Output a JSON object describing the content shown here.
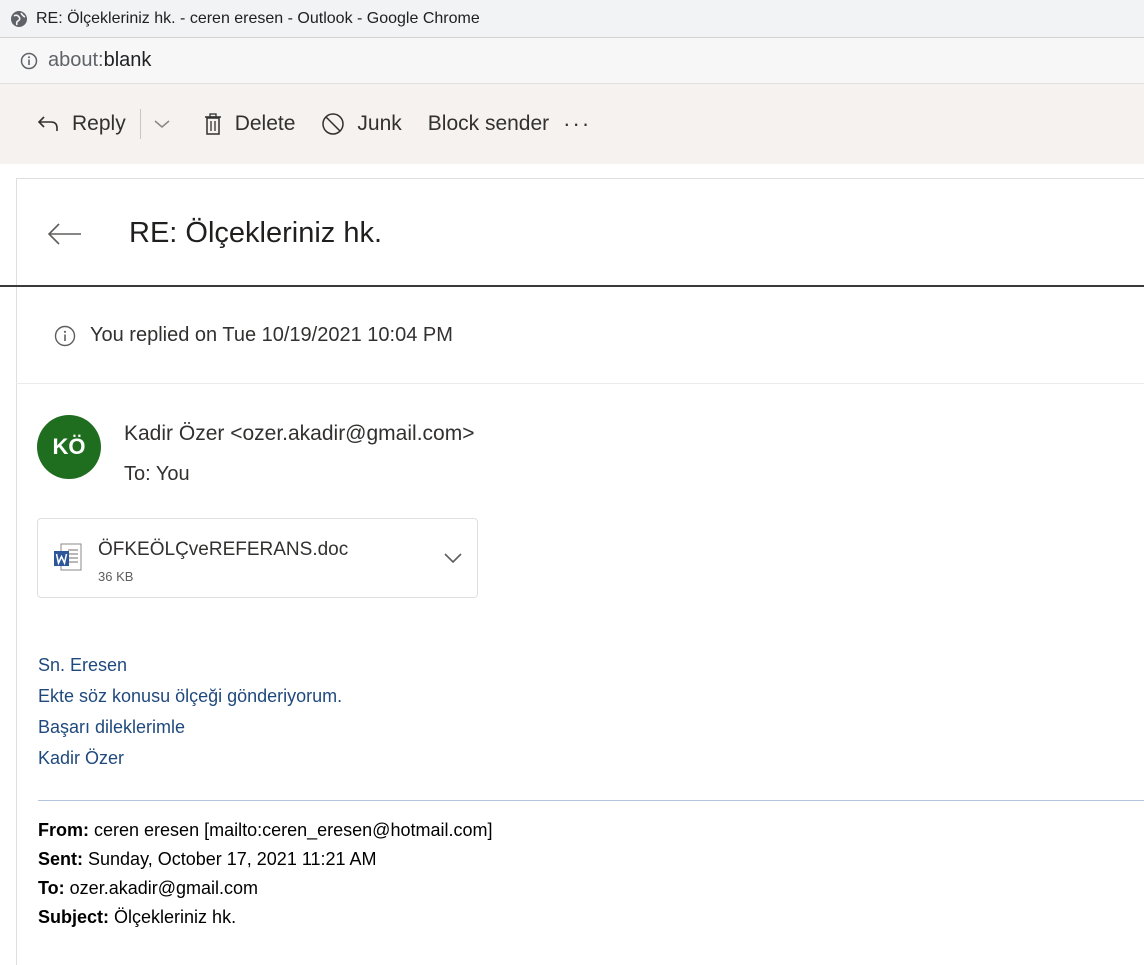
{
  "window": {
    "title": "RE: Ölçekleriniz hk. - ceren eresen - Outlook - Google Chrome",
    "url_scheme": "about:",
    "url_rest": "blank"
  },
  "toolbar": {
    "reply_label": "Reply",
    "delete_label": "Delete",
    "junk_label": "Junk",
    "block_label": "Block sender",
    "more_label": "···"
  },
  "message": {
    "subject": "RE: Ölçekleriniz hk.",
    "replied_notice": "You replied on Tue 10/19/2021 10:04 PM",
    "avatar_initials": "KÖ",
    "avatar_color": "#1f6e1f",
    "sender": "Kadir Özer <ozer.akadir@gmail.com>",
    "to_label": "To:",
    "to_value": "You",
    "attachment": {
      "name": "ÖFKEÖLÇveREFERANS.doc",
      "size": "36 KB",
      "icon": "word-doc-icon"
    },
    "body": [
      "Sn. Eresen",
      "Ekte söz konusu ölçeği gönderiyorum.",
      "Başarı dileklerimle",
      "Kadir Özer"
    ],
    "body_color": "#1f497d",
    "quoted": {
      "from_label": "From:",
      "from_value": "ceren eresen [mailto:ceren_eresen@hotmail.com]",
      "sent_label": "Sent:",
      "sent_value": "Sunday, October 17, 2021 11:21 AM",
      "to_label": "To:",
      "to_value": "ozer.akadir@gmail.com",
      "subject_label": "Subject:",
      "subject_value": "Ölçekleriniz hk."
    }
  }
}
